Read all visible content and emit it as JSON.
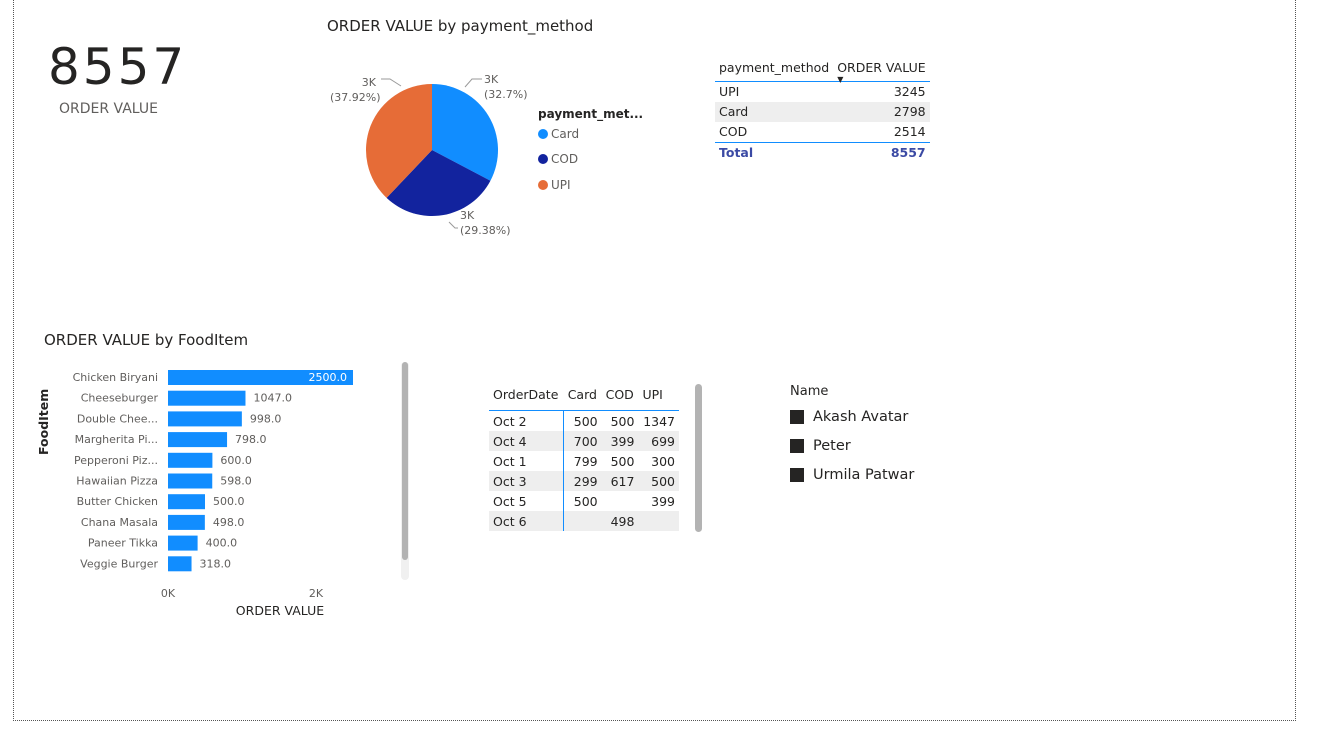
{
  "kpi": {
    "value": "8557",
    "label": "ORDER VALUE"
  },
  "pie": {
    "title": "ORDER VALUE by payment_method",
    "legend_title": "payment_met...",
    "legend": [
      {
        "label": "Card",
        "color": "#118dff"
      },
      {
        "label": "COD",
        "color": "#12239e"
      },
      {
        "label": "UPI",
        "color": "#e66c37"
      }
    ],
    "labels": [
      {
        "value": "3K",
        "pct": "(32.7%)"
      },
      {
        "value": "3K",
        "pct": "(29.38%)"
      },
      {
        "value": "3K",
        "pct": "(37.92%)"
      }
    ]
  },
  "payment_table": {
    "headers": [
      "payment_method",
      "ORDER VALUE"
    ],
    "rows": [
      [
        "UPI",
        "3245"
      ],
      [
        "Card",
        "2798"
      ],
      [
        "COD",
        "2514"
      ]
    ],
    "total": [
      "Total",
      "8557"
    ]
  },
  "bar": {
    "title": "ORDER VALUE by FoodItem",
    "ylabel": "FoodItem",
    "xlabel": "ORDER VALUE",
    "ticks": [
      "0K",
      "2K"
    ]
  },
  "chart_data": [
    {
      "type": "pie",
      "title": "ORDER VALUE by payment_method",
      "categories": [
        "Card",
        "COD",
        "UPI"
      ],
      "values": [
        2798,
        2514,
        3245
      ]
    },
    {
      "type": "bar",
      "title": "ORDER VALUE by FoodItem",
      "xlabel": "ORDER VALUE",
      "ylabel": "FoodItem",
      "categories": [
        "Chicken Biryani",
        "Cheeseburger",
        "Double Chee...",
        "Margherita Pi...",
        "Pepperoni Piz...",
        "Hawaiian Pizza",
        "Butter Chicken",
        "Chana Masala",
        "Paneer Tikka",
        "Veggie Burger"
      ],
      "values": [
        2500.0,
        1047.0,
        998.0,
        798.0,
        600.0,
        598.0,
        500.0,
        498.0,
        400.0,
        318.0
      ],
      "value_labels": [
        "2500.0",
        "1047.0",
        "998.0",
        "798.0",
        "600.0",
        "598.0",
        "500.0",
        "498.0",
        "400.0",
        "318.0"
      ],
      "color": "#118dff"
    }
  ],
  "matrix": {
    "headers": [
      "OrderDate",
      "Card",
      "COD",
      "UPI"
    ],
    "rows": [
      [
        "Oct 2",
        "500",
        "500",
        "1347"
      ],
      [
        "Oct 4",
        "700",
        "399",
        "699"
      ],
      [
        "Oct 1",
        "799",
        "500",
        "300"
      ],
      [
        "Oct 3",
        "299",
        "617",
        "500"
      ],
      [
        "Oct 5",
        "500",
        "",
        "399"
      ],
      [
        "Oct 6",
        "",
        "498",
        ""
      ]
    ]
  },
  "slicer": {
    "title": "Name",
    "items": [
      "Akash Avatar",
      "Peter",
      "Urmila Patwar"
    ]
  }
}
